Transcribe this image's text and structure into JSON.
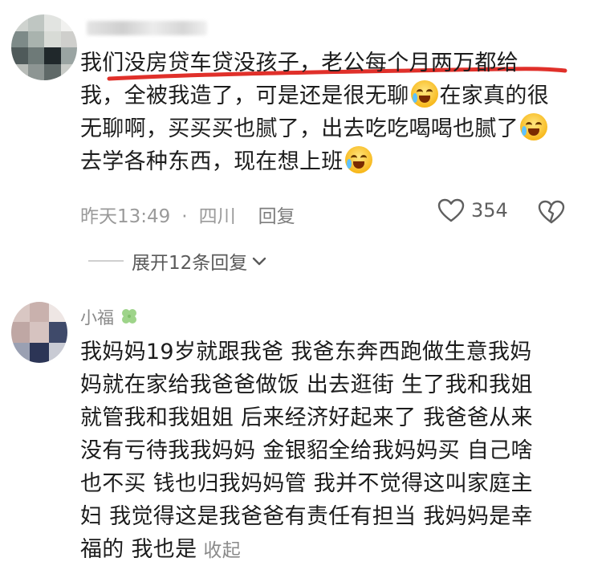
{
  "comment1": {
    "lines": [
      "我们没房贷车贷没孩子，老公每个月两万都给",
      "我，全被我造了，可是还是很无聊",
      "在家真的很",
      "无聊啊，买买买也腻了，出去吃吃喝喝也腻了",
      "去学各种东西，现在想上班"
    ],
    "time": "昨天13:49",
    "dot": "·",
    "location": "四川",
    "reply": "回复",
    "likes": "354",
    "expand": "展开12条回复"
  },
  "comment2": {
    "username": "小福",
    "lines": [
      "我妈妈19岁就跟我爸 我爸东奔西跑做生意我妈",
      "妈就在家给我爸爸做饭 出去逛街 生了我和我姐",
      "就管我和我姐姐 后来经济好起来了 我爸爸从来",
      "没有亏待我我妈妈 金银貂全给我妈妈买 自己啥",
      "也不买 钱也归我妈妈管 我并不觉得这叫家庭主",
      "妇 我觉得这是我爸爸有责任有担当 我妈妈是幸",
      "福的 我也是"
    ],
    "collapse": "收起"
  },
  "icons": {
    "emoji": "crying-laughing-emoji",
    "clover": "four-leaf-clover-icon",
    "like": "heart-icon",
    "dislike": "broken-heart-icon",
    "chevron": "chevron-down-icon"
  }
}
